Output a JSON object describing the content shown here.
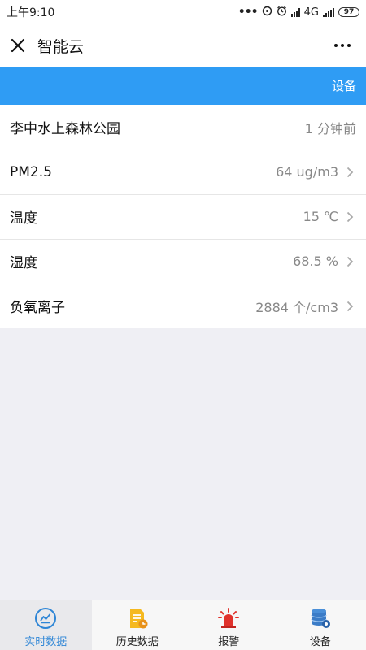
{
  "status_bar": {
    "time": "上午9:10",
    "network": "4G",
    "battery": "97"
  },
  "header": {
    "title": "智能云",
    "close_icon": "close-icon",
    "more_icon": "more-icon"
  },
  "banner": {
    "device_label": "设备"
  },
  "readings": [
    {
      "label": "李中水上森林公园",
      "value": "1 分钟前"
    },
    {
      "label": "PM2.5",
      "value": "64 ug/m3"
    },
    {
      "label": "温度",
      "value": "15 ℃"
    },
    {
      "label": "湿度",
      "value": "68.5 %"
    },
    {
      "label": "负氧离子",
      "value": "2884 个/cm3"
    }
  ],
  "tabs": [
    {
      "label": "实时数据",
      "icon": "realtime-chart-icon",
      "active": true
    },
    {
      "label": "历史数据",
      "icon": "history-document-icon",
      "active": false
    },
    {
      "label": "报警",
      "icon": "alarm-siren-icon",
      "active": false
    },
    {
      "label": "设备",
      "icon": "device-database-icon",
      "active": false
    }
  ],
  "colors": {
    "accent": "#2f9cf4",
    "active_tab_text": "#2f86d6",
    "value_text": "#888888",
    "background": "#efeff4"
  }
}
